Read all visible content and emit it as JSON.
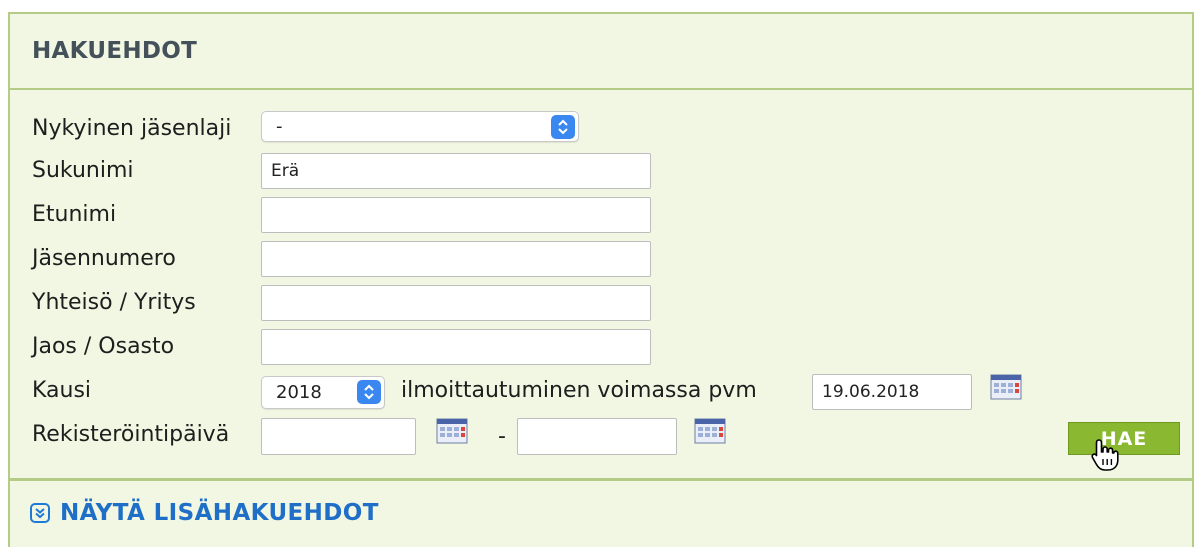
{
  "panel": {
    "title": "HAKUEHDOT"
  },
  "form": {
    "jasenlaji": {
      "label": "Nykyinen jäsenlaji",
      "selected": "-"
    },
    "sukunimi": {
      "label": "Sukunimi",
      "value": "Erä"
    },
    "etunimi": {
      "label": "Etunimi",
      "value": ""
    },
    "jasennumero": {
      "label": "Jäsennumero",
      "value": ""
    },
    "yhteiso": {
      "label": "Yhteisö / Yritys",
      "value": ""
    },
    "jaos": {
      "label": "Jaos / Osasto",
      "value": ""
    },
    "kausi": {
      "label": "Kausi",
      "selected": "2018",
      "date_label": "ilmoittautuminen voimassa pvm",
      "date_value": "19.06.2018"
    },
    "rekisterointi": {
      "label": "Rekisteröintipäivä",
      "from": "",
      "separator": "-",
      "to": ""
    }
  },
  "buttons": {
    "search": "HAE"
  },
  "more_link": {
    "label": "NÄYTÄ LISÄHAKUEHDOT"
  },
  "icons": {
    "calendar": "calendar-icon",
    "select_arrow": "select-arrows-icon",
    "expand": "chevron-double-down-icon",
    "cursor": "hand-pointer-icon"
  },
  "colors": {
    "panel_bg": "#f1f7e2",
    "panel_border": "#b5cc87",
    "button_green": "#8ab831",
    "link_blue": "#1f6fc8",
    "select_blue": "#3b87f0"
  }
}
